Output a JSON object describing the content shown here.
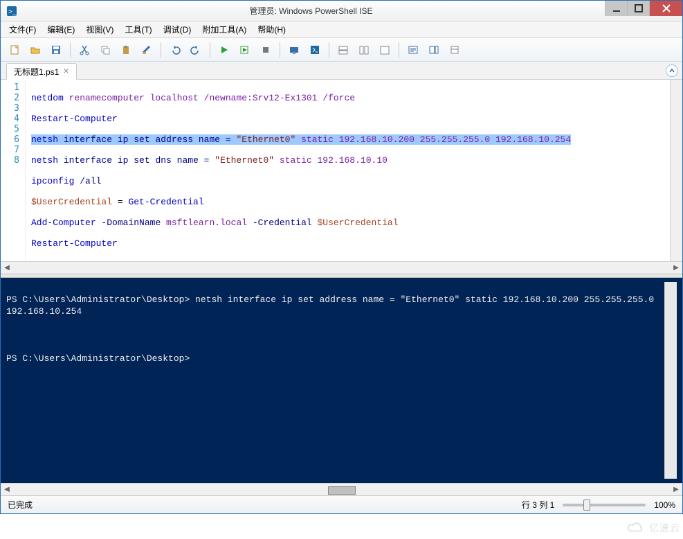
{
  "window": {
    "title": "管理员: Windows PowerShell ISE"
  },
  "menus": [
    {
      "label": "文件(F)"
    },
    {
      "label": "编辑(E)"
    },
    {
      "label": "视图(V)"
    },
    {
      "label": "工具(T)"
    },
    {
      "label": "调试(D)"
    },
    {
      "label": "附加工具(A)"
    },
    {
      "label": "帮助(H)"
    }
  ],
  "tab": {
    "label": "无标题1.ps1"
  },
  "code_lines": [
    {
      "n": "1"
    },
    {
      "n": "2"
    },
    {
      "n": "3"
    },
    {
      "n": "4"
    },
    {
      "n": "5"
    },
    {
      "n": "6"
    },
    {
      "n": "7"
    },
    {
      "n": "8"
    }
  ],
  "code": {
    "line1": {
      "a": "netdom",
      "b": " renamecomputer localhost /newname:Srv12-Ex1301 /force"
    },
    "line2": {
      "a": "Restart-Computer"
    },
    "line3": {
      "a": "netsh",
      "b": " interface ip set address name = ",
      "c": "\"Ethernet0\"",
      "d": " static 192.168.10.200 255.255.255.0 192.168.10.254"
    },
    "line4": {
      "a": "netsh",
      "b": " interface ip set dns name = ",
      "c": "\"Ethernet0\"",
      "d": " static 192.168.10.10"
    },
    "line5": {
      "a": "ipconfig",
      "b": " /all"
    },
    "line6": {
      "a": "$UserCredential",
      "b": " = ",
      "c": "Get-Credential"
    },
    "line7": {
      "a": "Add-Computer",
      "b": " -DomainName ",
      "c": "msftlearn.local",
      "d": " -Credential ",
      "e": "$UserCredential"
    },
    "line8": {
      "a": "Restart-Computer"
    }
  },
  "console": {
    "line1": "PS C:\\Users\\Administrator\\Desktop> netsh interface ip set address name = \"Ethernet0\" static 192.168.10.200 255.255.255.0 192.168.10.254",
    "blank": "",
    "line2": "PS C:\\Users\\Administrator\\Desktop> "
  },
  "status": {
    "left": "已完成",
    "pos": "行 3 列 1",
    "zoom": "100%"
  },
  "watermark": "亿速云"
}
